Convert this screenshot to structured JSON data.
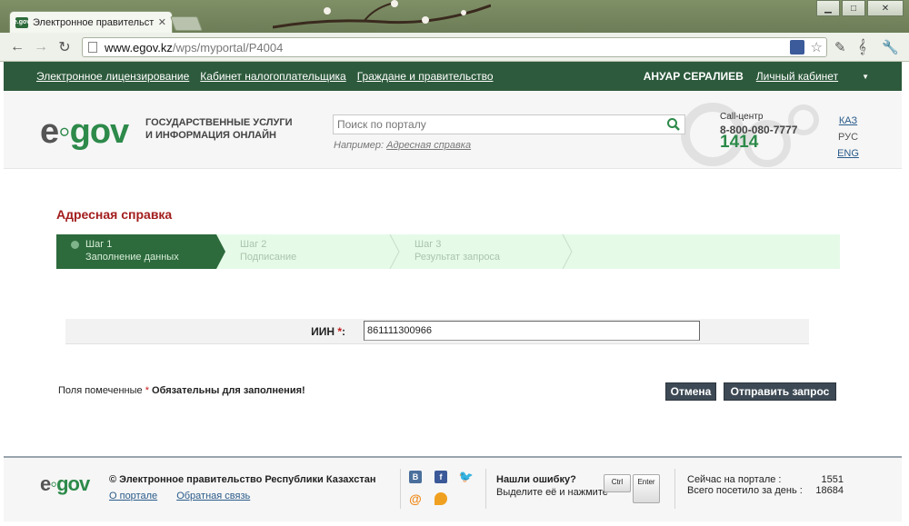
{
  "browser": {
    "tab_title": "Электронное правительство",
    "tab_favicon": "e.gov",
    "url_host": "www.egov.kz",
    "url_path": "/wps/myportal/P4004"
  },
  "topnav": {
    "links": [
      "Электронное лицензирование",
      "Кабинет налогоплательщика",
      "Граждане и правительство"
    ],
    "user_name": "АНУАР СЕРАЛИЕВ",
    "cabinet": "Личный кабинет"
  },
  "header": {
    "logo_e": "e",
    "logo_gov": "gov",
    "tagline_1": "ГОСУДАРСТВЕННЫЕ УСЛУГИ",
    "tagline_2": "И ИНФОРМАЦИЯ ОНЛАЙН",
    "search_placeholder": "Поиск по порталу",
    "example_label": "Например:",
    "example_link": "Адресная справка",
    "call_label": "Call-центр",
    "call_phone": "8-800-080-7777",
    "call_short": "1414",
    "langs": [
      "КАЗ",
      "РУС",
      "ENG"
    ]
  },
  "service": {
    "title": "Адресная справка"
  },
  "steps": [
    {
      "num": "Шаг 1",
      "label": "Заполнение данных"
    },
    {
      "num": "Шаг 2",
      "label": "Подписание"
    },
    {
      "num": "Шаг 3",
      "label": "Результат запроса"
    }
  ],
  "form": {
    "iin_label": "ИИН",
    "iin_req": "*",
    "iin_colon": ":",
    "iin_value": "861111300966"
  },
  "required_note": {
    "prefix": "Поля помеченные",
    "star": "*",
    "bold": "Обязательны для заполнения!"
  },
  "buttons": {
    "cancel": "Отмена",
    "send": "Отправить запрос"
  },
  "footer": {
    "copyright": "© Электронное правительство Республики Казахстан",
    "about": "О портале",
    "feedback": "Обратная связь",
    "error_title": "Нашли ошибку?",
    "error_hint": "Выделите её и нажмите",
    "key_ctrl": "Ctrl",
    "key_enter": "Enter",
    "online_label": "Сейчас на портале :",
    "online_value": "1551",
    "visits_label": "Всего посетило за день :",
    "visits_value": "18684"
  },
  "colors": {
    "brand_green": "#2d5a3c",
    "accent_green": "#2d8a4a",
    "title_red": "#a31d1d",
    "button_dark": "#3d4a55"
  }
}
